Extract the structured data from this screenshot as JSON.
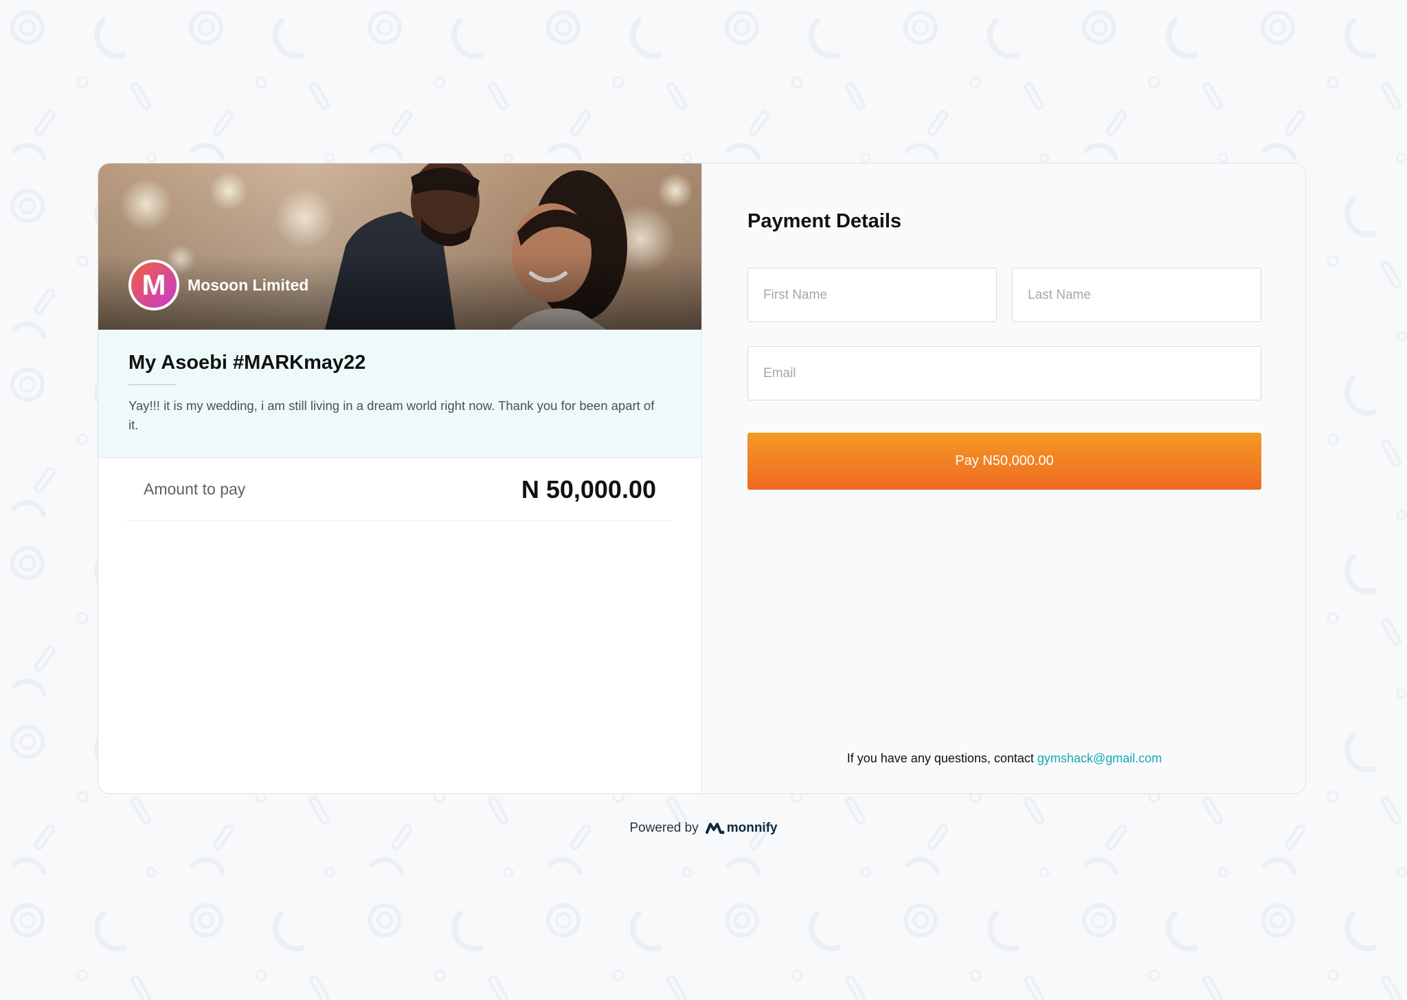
{
  "merchant": {
    "avatar_letter": "M",
    "name": "Mosoon Limited"
  },
  "event": {
    "title": "My Asoebi #MARKmay22",
    "description": "Yay!!! it is my wedding, i am still living in a dream world right now. Thank you for been apart of it."
  },
  "amount": {
    "label": "Amount to pay",
    "value": "N 50,000.00"
  },
  "payment": {
    "title": "Payment Details",
    "first_name_placeholder": "First Name",
    "last_name_placeholder": "Last Name",
    "email_placeholder": "Email",
    "pay_label": "Pay N50,000.00",
    "contact_text": "If you have any questions, contact ",
    "contact_email": "gymshack@gmail.com"
  },
  "footer": {
    "powered_by": "Powered by",
    "brand": "monnify"
  },
  "colors": {
    "accent_start": "#f39a24",
    "accent_end": "#ef6a22",
    "link": "#15a8b5",
    "event_bg": "#eefaf9"
  }
}
